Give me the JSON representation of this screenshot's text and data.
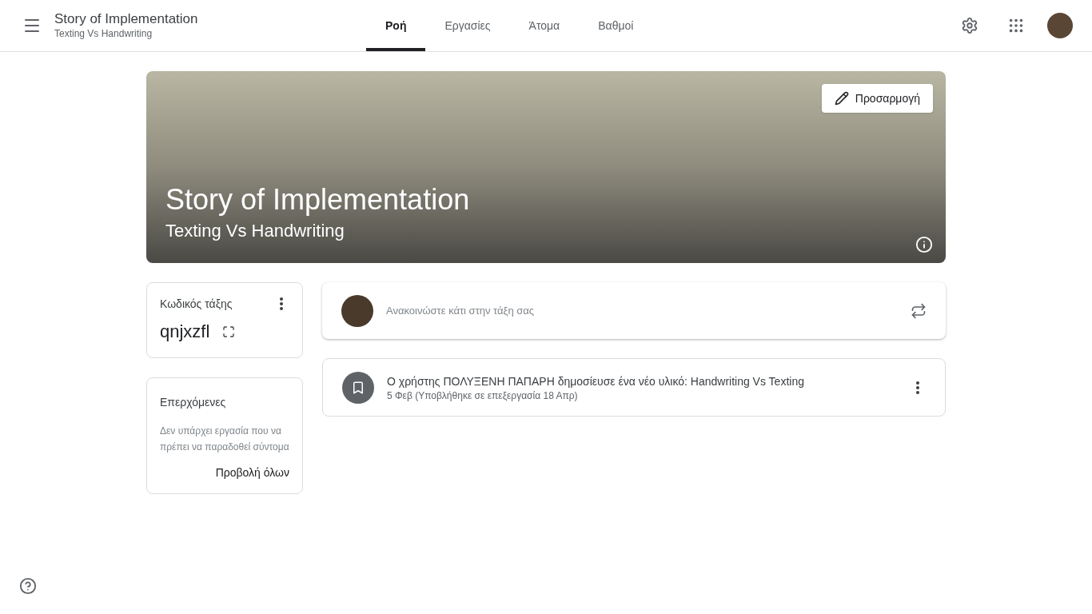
{
  "header": {
    "title": "Story of Implementation",
    "subtitle": "Texting Vs Handwriting"
  },
  "tabs": [
    {
      "label": "Ροή",
      "selected": true
    },
    {
      "label": "Εργασίες",
      "selected": false
    },
    {
      "label": "Άτομα",
      "selected": false
    },
    {
      "label": "Βαθμοί",
      "selected": false
    }
  ],
  "banner": {
    "title": "Story of Implementation",
    "subtitle": "Texting Vs Handwriting",
    "customize_button": "Προσαρμογή"
  },
  "class_code": {
    "label": "Κωδικός τάξης",
    "code": "qnjxzfl"
  },
  "upcoming": {
    "title": "Επερχόμενες",
    "message": "Δεν υπάρχει εργασία που να πρέπει να παραδοθεί σύντομα",
    "view_all": "Προβολή όλων"
  },
  "announce": {
    "placeholder": "Ανακοινώστε κάτι στην τάξη σας"
  },
  "posts": [
    {
      "title": "Ο χρήστης ΠΟΛΥΞΕΝΗ ΠΑΠΑΡΗ δημοσίευσε ένα νέο υλικό: Handwriting Vs Texting",
      "meta": "5 Φεβ (Υποβλήθηκε σε επεξεργασία 18 Απρ)"
    }
  ]
}
